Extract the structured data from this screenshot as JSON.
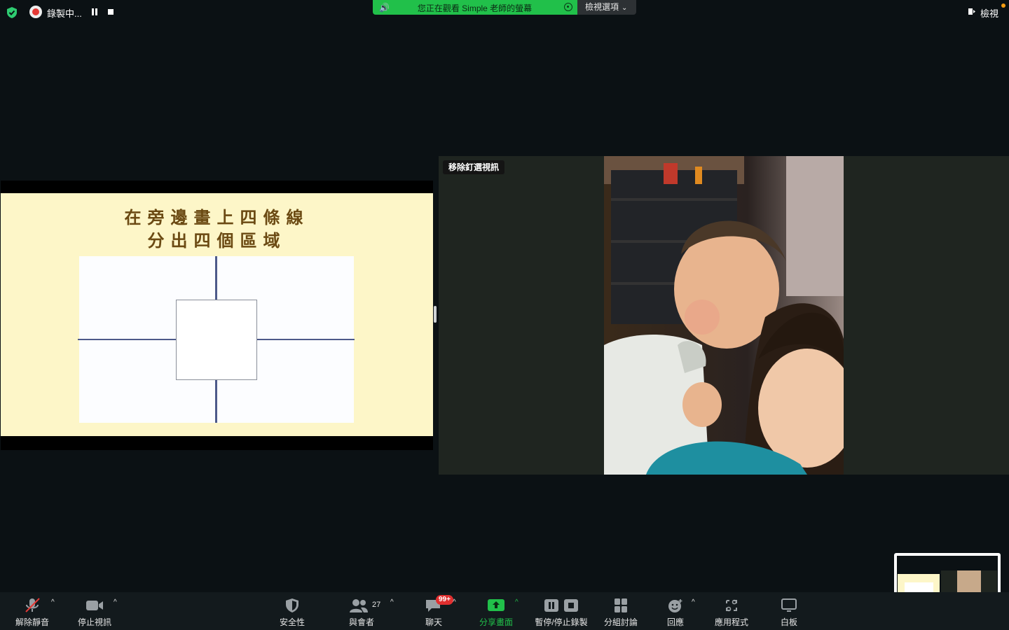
{
  "top_bar": {
    "recording_label": "錄製中...",
    "viewing_banner": "您正在觀看 Simple 老師的螢幕",
    "view_options_label": "檢視選項",
    "view_label": "檢視"
  },
  "slide": {
    "title_line1": "在旁邊畫上四條線",
    "title_line2": "分出四個區域"
  },
  "video": {
    "unpin_label": "移除釘選視訊"
  },
  "toolbar": {
    "unmute": "解除靜音",
    "stop_video": "停止視訊",
    "security": "安全性",
    "participants": "與會者",
    "participants_count": "27",
    "chat": "聊天",
    "chat_badge": "99+",
    "share_screen": "分享畫面",
    "pause_stop_recording": "暫停/停止錄製",
    "breakout_rooms": "分組討論",
    "reactions": "回應",
    "apps": "應用程式",
    "whiteboard": "白板"
  },
  "colors": {
    "banner_green": "#21c04a",
    "slide_bg": "#fdf6c8",
    "title_brown": "#6b4a13",
    "line_blue": "#4d5a8a",
    "badge_red": "#e02f2f"
  }
}
